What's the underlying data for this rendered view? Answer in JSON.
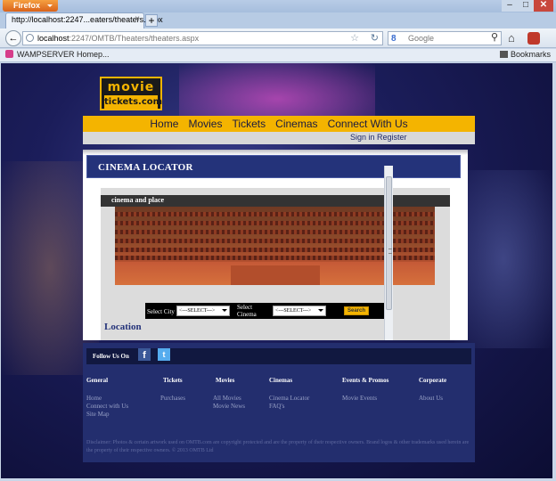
{
  "browser": {
    "app_button": "Firefox",
    "tab_title": "http://localhost:2247...eaters/theaters.aspx",
    "url_host": "localhost",
    "url_rest": ":2247/OMTB/Theaters/theaters.aspx",
    "search_engine_letter": "8",
    "search_placeholder": "Google",
    "bookmark_item": "WAMPSERVER Homep...",
    "bookmarks_label": "Bookmarks"
  },
  "site": {
    "logo_line1": "movie",
    "logo_line2": "tickets.com",
    "nav": [
      "Home",
      "Movies",
      "Tickets",
      "Cinemas",
      "Connect With Us"
    ],
    "sign_in": "Sign in",
    "register": "Register"
  },
  "page": {
    "heading": "CINEMA LOCATOR",
    "panel_title": "cinema and place",
    "select_city_label": "Select City",
    "select_city_value": "<---SELECT--->",
    "select_cinema_label_1": "Select",
    "select_cinema_label_2": "Cinema",
    "select_cinema_value": "<---SELECT--->",
    "search_button": "Search",
    "location_heading": "Location"
  },
  "footer": {
    "follow": "Follow Us On",
    "facebook_glyph": "f",
    "twitter_glyph": "t",
    "columns": [
      {
        "title": "General",
        "links": [
          "Home",
          "Connect with Us",
          "Site Map"
        ]
      },
      {
        "title": "Tickets",
        "links": [
          "Purchases"
        ]
      },
      {
        "title": "Movies",
        "links": [
          "All Movies",
          "Movie News"
        ]
      },
      {
        "title": "Cinemas",
        "links": [
          "Cinema Locator",
          "FAQ's"
        ]
      },
      {
        "title": "Events & Promos",
        "links": [
          "Movie Events"
        ]
      },
      {
        "title": "Corporate",
        "links": [
          "About Us"
        ]
      }
    ],
    "disclaimer": "Disclaimer: Photos & certain artwork used on OMTB.com are copyright protected and are the property of their respective owners. Brand logos & other trademarks used herein are the property of their respective owners. © 2013 OMTB Ltd"
  }
}
